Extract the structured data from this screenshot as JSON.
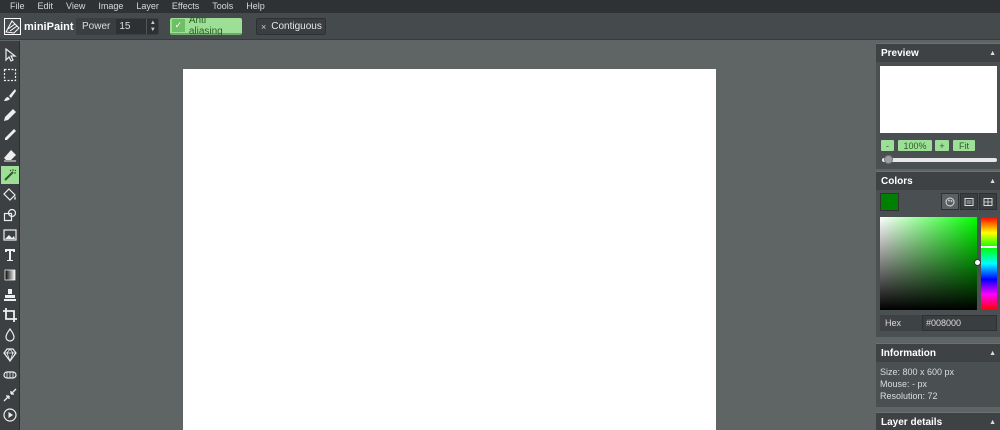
{
  "menu": [
    "File",
    "Edit",
    "View",
    "Image",
    "Layer",
    "Effects",
    "Tools",
    "Help"
  ],
  "app": {
    "name": "miniPaint"
  },
  "options": {
    "power_label": "Power",
    "power_value": "15",
    "stepper_up": "▲",
    "stepper_down": "▼",
    "anti_aliasing_label": "Anti aliasing",
    "anti_aliasing_check": "✓",
    "contiguous_label": "Contiguous",
    "contiguous_check": "×"
  },
  "tools": [
    {
      "name": "select-tool-icon"
    },
    {
      "name": "selection-rect-icon"
    },
    {
      "name": "brush-icon"
    },
    {
      "name": "pencil-icon"
    },
    {
      "name": "color-picker-icon"
    },
    {
      "name": "erase-icon"
    },
    {
      "name": "magic-wand-icon",
      "active": true
    },
    {
      "name": "fill-icon"
    },
    {
      "name": "shape-icon"
    },
    {
      "name": "image-icon"
    },
    {
      "name": "text-icon"
    },
    {
      "name": "gradient-icon"
    },
    {
      "name": "clone-icon"
    },
    {
      "name": "crop-icon"
    },
    {
      "name": "blur-icon"
    },
    {
      "name": "sharpen-icon"
    },
    {
      "name": "desaturate-icon"
    },
    {
      "name": "bulge-pinch-icon"
    },
    {
      "name": "animation-icon"
    }
  ],
  "preview": {
    "title": "Preview",
    "caret": "▲",
    "zoom_out": "-",
    "zoom_level": "100%",
    "zoom_in": "+",
    "fit": "Fit"
  },
  "colors": {
    "title": "Colors",
    "caret": "▲",
    "current": "#008000",
    "hex_label": "Hex",
    "hex_value": "#008000"
  },
  "information": {
    "title": "Information",
    "caret": "▲",
    "size": "Size: 800 x 600 px",
    "mouse": "Mouse: - px",
    "resolution": "Resolution: 72"
  },
  "layer_details": {
    "title": "Layer details",
    "caret": "▲"
  },
  "accent_color": "#9edf97"
}
